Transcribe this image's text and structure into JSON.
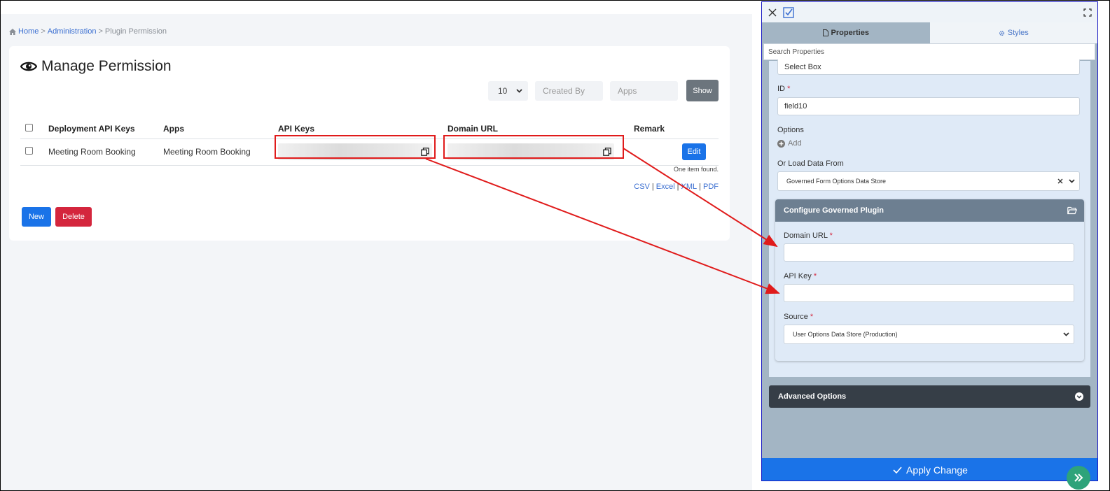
{
  "breadcrumb": {
    "home": "Home",
    "admin": "Administration",
    "current": "Plugin Permission",
    "sep": ">"
  },
  "page": {
    "title": "Manage Permission"
  },
  "filters": {
    "page_size": "10",
    "created_by_placeholder": "Created By",
    "apps_placeholder": "Apps",
    "show_label": "Show"
  },
  "table": {
    "headers": [
      "Deployment API Keys",
      "Apps",
      "API Keys",
      "Domain URL",
      "Remark"
    ],
    "rows": [
      {
        "deployment_api_key": "Meeting Room Booking",
        "app": "Meeting Room Booking",
        "edit_label": "Edit"
      }
    ],
    "found_text": "One item found.",
    "exports": [
      "CSV",
      "Excel",
      "XML",
      "PDF"
    ]
  },
  "actions": {
    "new_label": "New",
    "delete_label": "Delete"
  },
  "panel": {
    "tabs": [
      "Properties",
      "Styles"
    ],
    "search_placeholder": "Search Properties",
    "label_value": "Select Box",
    "id_label": "ID",
    "id_value": "field10",
    "options_label": "Options",
    "add_label": "Add",
    "load_from_label": "Or Load Data From",
    "load_from_value": "Governed Form Options Data Store",
    "configure_title": "Configure Governed Plugin",
    "domain_url_label": "Domain URL",
    "api_key_label": "API Key",
    "source_label": "Source",
    "source_value": "User Options Data Store (Production)",
    "advanced_label": "Advanced Options",
    "apply_label": "Apply Change",
    "required_mark": "*"
  },
  "colors": {
    "primary": "#1a73e8",
    "danger": "#d4263d",
    "annotation_red": "#e01b1b",
    "panel_bg": "#a3b5c4",
    "fab": "#2ea37a"
  }
}
